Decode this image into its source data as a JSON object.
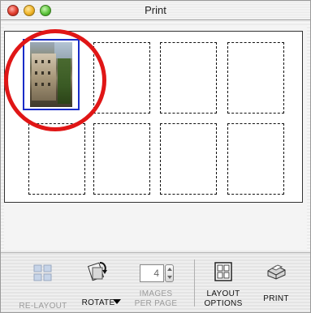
{
  "window": {
    "title": "Print"
  },
  "layout": {
    "slots_per_row": 4,
    "rows": 2,
    "selected_slot": 1
  },
  "toolbar": {
    "relayout_label": "RE-LAYOUT",
    "rotate_label": "ROTATE",
    "images_per_page_label_line1": "IMAGES",
    "images_per_page_label_line2": "PER PAGE",
    "images_per_page_value": "4",
    "layout_options_line1": "LAYOUT",
    "layout_options_line2": "OPTIONS",
    "print_label": "PRINT"
  },
  "colors": {
    "selection_border": "#1a2cc8",
    "annotation_circle": "#e01616"
  }
}
